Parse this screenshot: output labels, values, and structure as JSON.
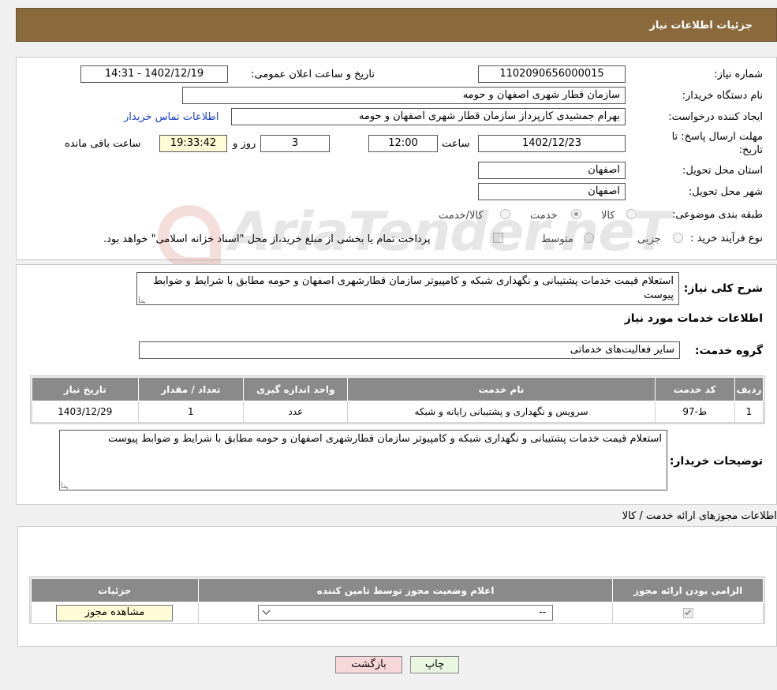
{
  "header": {
    "title": "جزئیات اطلاعات نیاز"
  },
  "form": {
    "need_number": {
      "label": "شماره نیاز:",
      "value": "1102090656000015"
    },
    "announce_datetime": {
      "label": "تاریخ و ساعت اعلان عمومی:",
      "value": "1402/12/19 - 14:31"
    },
    "buyer_org": {
      "label": "نام دستگاه خریدار:",
      "value": "سازمان قطار شهری اصفهان و حومه"
    },
    "requester": {
      "label": "ایجاد کننده درخواست:",
      "value": "بهرام جمشیدی کارپرداز سازمان قطار شهری اصفهان و حومه",
      "contact_link": "اطلاعات تماس خریدار"
    },
    "deadline": {
      "label": "مهلت ارسال پاسخ: تا تاریخ:",
      "date": "1402/12/23",
      "time_label": "ساعت",
      "time": "12:00",
      "days": "3",
      "days_label": "روز و",
      "remaining": "19:33:42",
      "remaining_label": "ساعت باقی مانده"
    },
    "province": {
      "label": "استان محل تحویل:",
      "value": "اصفهان"
    },
    "city": {
      "label": "شهر محل تحویل:",
      "value": "اصفهان"
    },
    "category": {
      "label": "طبقه بندی موضوعی:",
      "options": [
        {
          "label": "کالا",
          "selected": false
        },
        {
          "label": "خدمت",
          "selected": true
        },
        {
          "label": "کالا/خدمت",
          "selected": false
        }
      ]
    },
    "purchase_process": {
      "label": "نوع فرآیند خرید :",
      "options": [
        {
          "label": "جزیی",
          "selected": false
        },
        {
          "label": "متوسط",
          "selected": false
        }
      ],
      "payment_checkbox_label": "پرداخت تمام یا بخشی از مبلغ خرید،از محل \"اسناد خزانه اسلامی\" خواهد بود."
    }
  },
  "summary": {
    "label": "شرح کلی نیاز:",
    "value": "استعلام قیمت خدمات پشتیبانی و نگهداری شبکه و کامپیوتر سازمان قطارشهری اصفهان و حومه مطابق با شرایط و ضوابط پیوست"
  },
  "services": {
    "section_title": "اطلاعات خدمات مورد نیاز",
    "group_label": "گروه خدمت:",
    "group_value": "سایر فعالیت‌های خدماتی",
    "table": {
      "headers": [
        "ردیف",
        "کد خدمت",
        "نام خدمت",
        "واحد اندازه گیری",
        "تعداد / مقدار",
        "تاریخ نیاز"
      ],
      "rows": [
        [
          "1",
          "ط-97",
          "سرویس و نگهداری و پشتیبانی رایانه و شبکه",
          "عدد",
          "1",
          "1403/12/29"
        ]
      ]
    },
    "buyer_notes_label": "توضیحات خریدار:",
    "buyer_notes": "استعلام قیمت خدمات پشتیبانی و نگهداری شبکه و کامپیوتر سازمان قطارشهری اصفهان و حومه مطابق با شرایط و ضوابط پیوست"
  },
  "permits": {
    "section_title": "اطلاعات مجوزهای ارائه خدمت / کالا",
    "table": {
      "headers": [
        "الزامی بودن ارائه مجوز",
        "اعلام وضعیت مجوز توسط تامین کننده",
        "جزئیات"
      ],
      "rows": [
        {
          "required_checked": true,
          "status_selected": "--",
          "details_button": "مشاهده مجوز"
        }
      ]
    }
  },
  "actions": {
    "print": "چاپ",
    "back": "بازگشت"
  },
  "watermark": {
    "text": "AriaTender.neT"
  },
  "colors": {
    "header_bg": "#8a6a3d",
    "table_header_bg": "#8a8a8a",
    "link": "#1a3ecf",
    "back_button_bg": "#f8d7da",
    "print_button_bg": "#e9f7e1"
  }
}
